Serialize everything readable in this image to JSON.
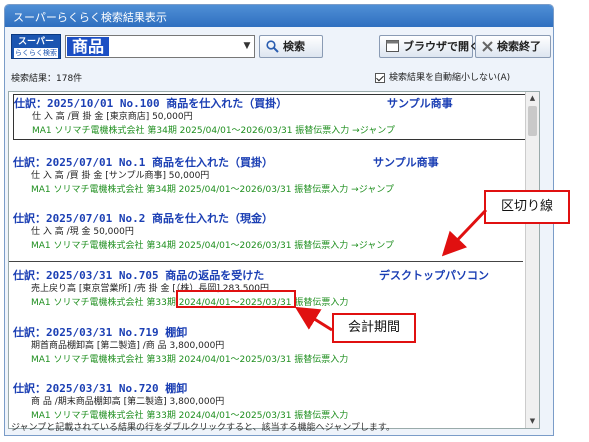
{
  "window": {
    "title": "スーパーらくらく検索結果表示"
  },
  "toolbar": {
    "logo_line1": "スーパー",
    "logo_line2": "らくらく検索",
    "search_category": "商品",
    "search_label": "検索",
    "browser_label": "ブラウザで開く",
    "exit_label": "検索終了"
  },
  "status": {
    "count": "検索結果：178件",
    "auto_shrink_label": "検索結果を自動縮小しない(A)",
    "auto_shrink_checked": true
  },
  "results": [
    {
      "head": "仕訳：2025/10/01 No.100 商品を仕入れた（買掛）",
      "partner": "サンプル商事",
      "line": "仕 入 高 /買 掛 金 [東京商店] 50,000円",
      "company": "MA1 ソリマチ電機株式会社 第34期 2025/04/01～2026/03/31 振替伝票入力 →ジャンプ"
    },
    {
      "head": "仕訳：2025/07/01 No.1 商品を仕入れた（買掛）",
      "partner": "サンプル商事",
      "line": "仕 入 高 /買 掛 金 [サンプル商事] 50,000円",
      "company": "MA1 ソリマチ電機株式会社 第34期 2025/04/01～2026/03/31 振替伝票入力 →ジャンプ"
    },
    {
      "head": "仕訳：2025/07/01 No.2 商品を仕入れた（現金）",
      "partner": "",
      "line": "仕 入 高 /現 金 50,000円",
      "company": "MA1 ソリマチ電機株式会社 第34期 2025/04/01～2026/03/31 振替伝票入力 →ジャンプ"
    },
    {
      "head": "仕訳：2025/03/31 No.705 商品の返品を受けた",
      "partner": "デスクトップパソコン",
      "line": "売上戻り高 [東京営業所] /売 掛 金 [（株）長岡] 283,500円",
      "company_prefix": "MA1 ソリマチ電機株式会社 第33期",
      "company_period": "2024/04/01～2025/03/31",
      "company_suffix": "振替伝票入力"
    },
    {
      "head": "仕訳：2025/03/31 No.719 棚卸",
      "partner": "",
      "line": "期首商品棚卸高 [第二製造] /商 品 3,800,000円",
      "company": "MA1 ソリマチ電機株式会社 第33期 2024/04/01～2025/03/31 振替伝票入力"
    },
    {
      "head": "仕訳：2025/03/31 No.720 棚卸",
      "partner": "",
      "line": "商 品 /期末商品棚卸高 [第二製造] 3,800,000円",
      "company": "MA1 ソリマチ電機株式会社 第33期 2024/04/01～2025/03/31 振替伝票入力"
    }
  ],
  "footer": "ジャンプと記載されている結果の行をダブルクリックすると、該当する機能へジャンプします。",
  "annotations": {
    "divider_label": "区切り線",
    "period_label": "会計期間"
  },
  "colors": {
    "heading": "#1b3fb4",
    "company": "#1f8f1f",
    "callout_border": "#e01010"
  }
}
